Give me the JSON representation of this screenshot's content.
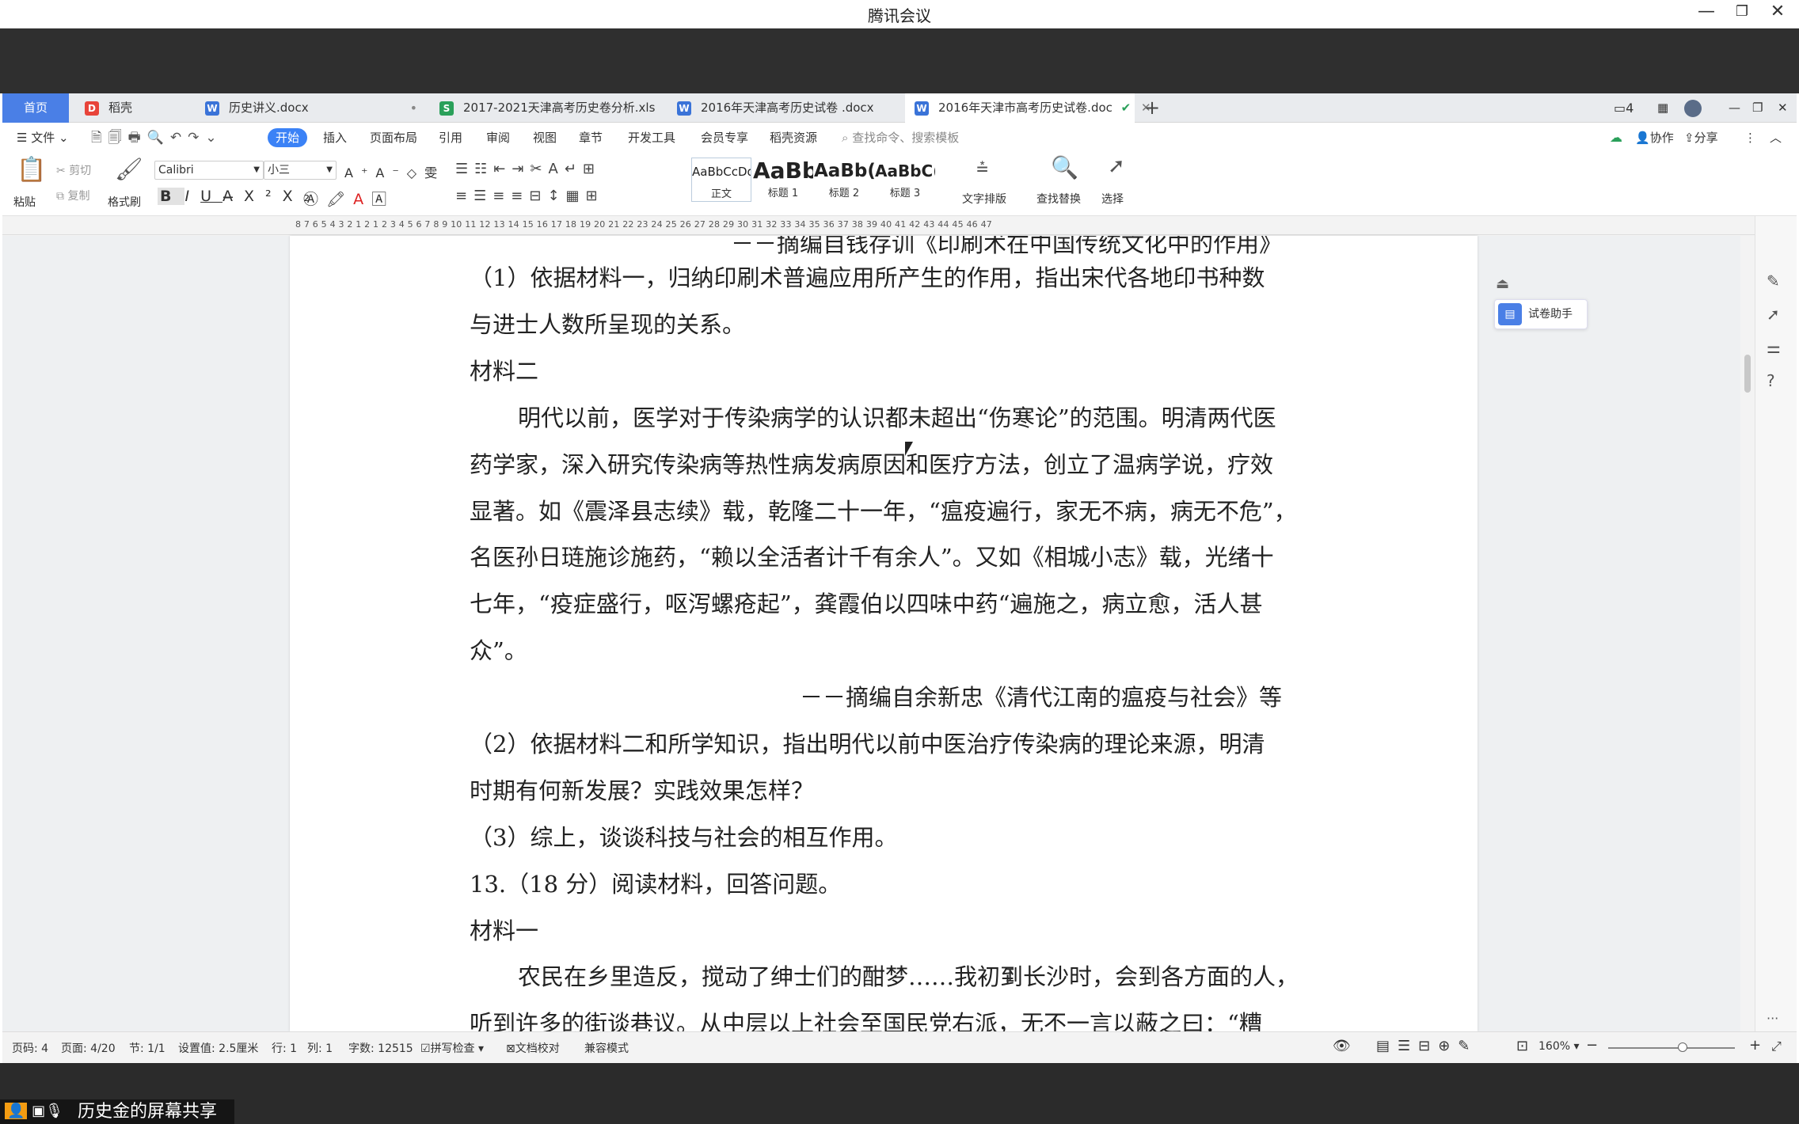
{
  "window": {
    "title": "腾讯会议"
  },
  "tabs": [
    {
      "label": "首页"
    },
    {
      "label": "稻壳"
    },
    {
      "label": "历史讲义.docx"
    },
    {
      "label": "2017-2021天津高考历史卷分析.xls"
    },
    {
      "label": "2016年天津高考历史试卷 .docx"
    },
    {
      "label": "2016年天津市高考历史试卷.doc"
    }
  ],
  "menu": {
    "file": "文件",
    "items": [
      "开始",
      "插入",
      "页面布局",
      "引用",
      "审阅",
      "视图",
      "章节",
      "开发工具",
      "会员专享",
      "稻壳资源"
    ],
    "search": "查找命令、搜索模板",
    "collab": "协作",
    "share": "分享"
  },
  "ribbon": {
    "paste": "粘贴",
    "cut": "剪切",
    "copy": "复制",
    "format_painter": "格式刷",
    "font": "Calibri",
    "size": "小三",
    "styles": [
      {
        "preview": "AaBbCcDd",
        "name": "正文"
      },
      {
        "preview": "AaBb",
        "name": "标题 1"
      },
      {
        "preview": "AaBb(",
        "name": "标题 2"
      },
      {
        "preview": "AaBbC(",
        "name": "标题 3"
      }
    ],
    "text_layout": "文字排版",
    "find_replace": "查找替换",
    "select": "选择"
  },
  "ruler": {
    "numbers": "8 7 6 5 4 3 2 1 2 1 2 3 4 5 6 7 8 9 10 11 12 13 14 15 16 17 18 19 20 21 22 23 24 25 26 27 28 29 30 31 32 33 34 35 36 37 38 39 40 41 42 43 44 45 46 47"
  },
  "side": {
    "assistant": "试卷助手"
  },
  "document": {
    "lines": [
      "－－摘编自钱存训《印刷术在中国传统文化中的作用》",
      "（1）依据材料一，归纳印刷术普遍应用所产生的作用，指出宋代各地印书种数",
      "与进士人数所呈现的关系。",
      "材料二",
      "明代以前，医学对于传染病学的认识都未超出“伤寒论”的范围。明清两代医",
      "药学家，深入研究传染病等热性病发病原因和医疗方法，创立了温病学说，疗效",
      "显著。如《震泽县志续》载，乾隆二十一年，“瘟疫遍行，家无不病，病无不危”，",
      "名医孙日琏施诊施药，“赖以全活者计千有余人”。又如《相城小志》载，光绪十",
      "七年，“疫症盛行，呕泻螺疮起”，龚霞伯以四味中药“遍施之，病立愈，活人甚",
      "众”。",
      "－－摘编自余新忠《清代江南的瘟疫与社会》等",
      "（2）依据材料二和所学知识，指出明代以前中医治疗传染病的理论来源，明清",
      "时期有何新发展？实践效果怎样？",
      "（3）综上，谈谈科技与社会的相互作用。",
      "13.（18 分）阅读材料，回答问题。",
      "材料一",
      "农民在乡里造反，搅动了绅士们的酣梦……我初到长沙时，会到各方面的人，",
      "听到许多的街谈巷议。从中层以上社会至国民党右派，无不一言以蔽之曰：“糟"
    ]
  },
  "status": {
    "page_code": "页码: 4",
    "page": "页面: 4/20",
    "section": "节: 1/1",
    "setting": "设置值: 2.5厘米",
    "row": "行: 1",
    "col": "列: 1",
    "words": "字数: 12515",
    "spell": "拼写检查",
    "proof": "文档校对",
    "compat": "兼容模式",
    "zoom": "160%"
  },
  "share": {
    "label": "历史金的屏幕共享"
  }
}
